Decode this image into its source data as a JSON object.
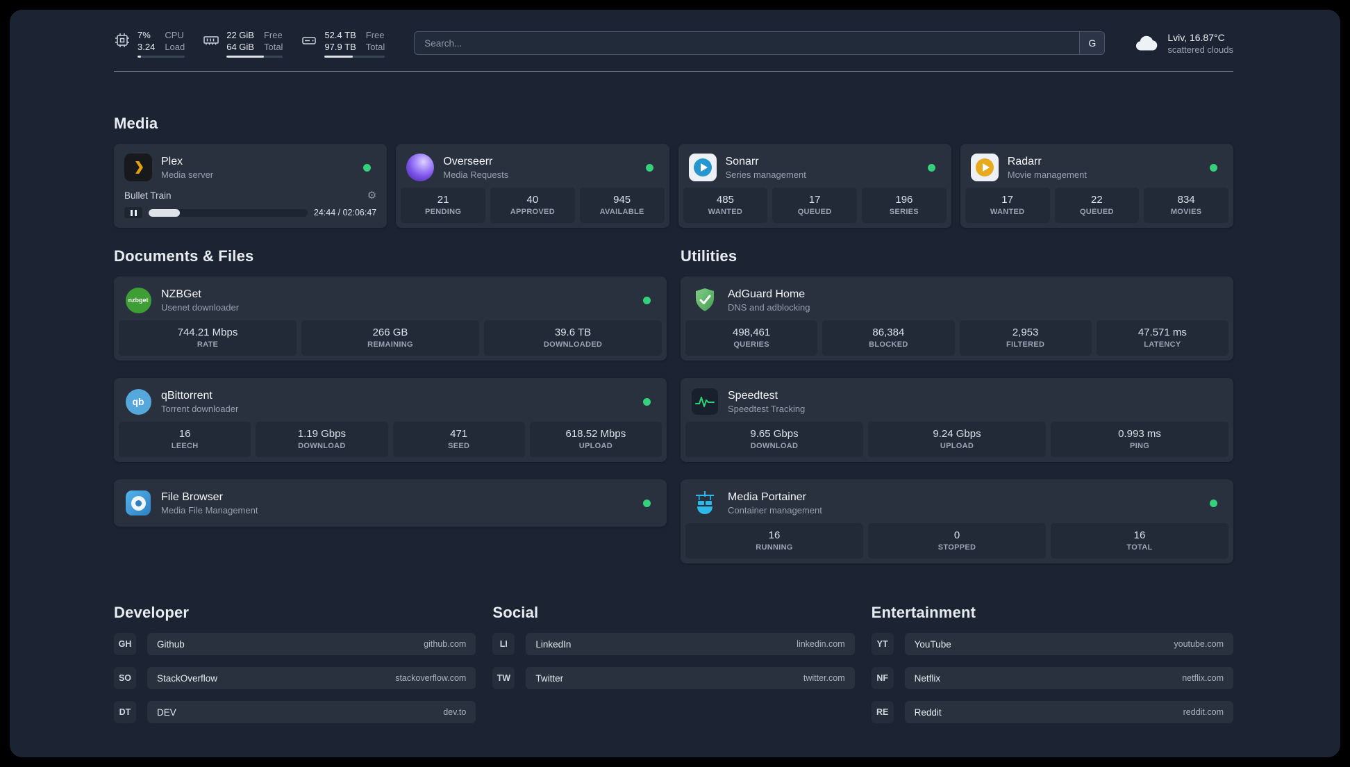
{
  "topbar": {
    "resources": [
      {
        "name": "cpu",
        "line1": "7%",
        "line2": "3.24",
        "label1": "CPU",
        "label2": "Load",
        "percent": 7
      },
      {
        "name": "memory",
        "line1": "22 GiB",
        "line2": "64 GiB",
        "label1": "Free",
        "label2": "Total",
        "percent": 66
      },
      {
        "name": "disk",
        "line1": "52.4 TB",
        "line2": "97.9 TB",
        "label1": "Free",
        "label2": "Total",
        "percent": 47
      }
    ],
    "search": {
      "placeholder": "Search...",
      "button_label": "G"
    },
    "weather": {
      "location": "Lviv, 16.87°C",
      "condition": "scattered clouds"
    }
  },
  "media": {
    "title": "Media",
    "plex": {
      "name": "Plex",
      "desc": "Media server",
      "status": "online",
      "now_playing": "Bullet Train",
      "time": "24:44 / 02:06:47",
      "progress_percent": 19.5
    },
    "overseerr": {
      "name": "Overseerr",
      "desc": "Media Requests",
      "status": "online",
      "stats": [
        {
          "value": "21",
          "label": "PENDING"
        },
        {
          "value": "40",
          "label": "APPROVED"
        },
        {
          "value": "945",
          "label": "AVAILABLE"
        }
      ]
    },
    "sonarr": {
      "name": "Sonarr",
      "desc": "Series management",
      "status": "online",
      "stats": [
        {
          "value": "485",
          "label": "WANTED"
        },
        {
          "value": "17",
          "label": "QUEUED"
        },
        {
          "value": "196",
          "label": "SERIES"
        }
      ]
    },
    "radarr": {
      "name": "Radarr",
      "desc": "Movie management",
      "status": "online",
      "stats": [
        {
          "value": "17",
          "label": "WANTED"
        },
        {
          "value": "22",
          "label": "QUEUED"
        },
        {
          "value": "834",
          "label": "MOVIES"
        }
      ]
    }
  },
  "documents": {
    "title": "Documents & Files",
    "nzbget": {
      "name": "NZBGet",
      "desc": "Usenet downloader",
      "status": "online",
      "icon_text": "nzbget",
      "stats": [
        {
          "value": "744.21 Mbps",
          "label": "RATE"
        },
        {
          "value": "266 GB",
          "label": "REMAINING"
        },
        {
          "value": "39.6 TB",
          "label": "DOWNLOADED"
        }
      ]
    },
    "qbittorrent": {
      "name": "qBittorrent",
      "desc": "Torrent downloader",
      "status": "online",
      "icon_text": "qb",
      "stats": [
        {
          "value": "16",
          "label": "LEECH"
        },
        {
          "value": "1.19 Gbps",
          "label": "DOWNLOAD"
        },
        {
          "value": "471",
          "label": "SEED"
        },
        {
          "value": "618.52 Mbps",
          "label": "UPLOAD"
        }
      ]
    },
    "filebrowser": {
      "name": "File Browser",
      "desc": "Media File Management",
      "status": "online"
    }
  },
  "utilities": {
    "title": "Utilities",
    "adguard": {
      "name": "AdGuard Home",
      "desc": "DNS and adblocking",
      "stats": [
        {
          "value": "498,461",
          "label": "QUERIES"
        },
        {
          "value": "86,384",
          "label": "BLOCKED"
        },
        {
          "value": "2,953",
          "label": "FILTERED"
        },
        {
          "value": "47.571 ms",
          "label": "LATENCY"
        }
      ]
    },
    "speedtest": {
      "name": "Speedtest",
      "desc": "Speedtest Tracking",
      "stats": [
        {
          "value": "9.65 Gbps",
          "label": "DOWNLOAD"
        },
        {
          "value": "9.24 Gbps",
          "label": "UPLOAD"
        },
        {
          "value": "0.993 ms",
          "label": "PING"
        }
      ]
    },
    "portainer": {
      "name": "Media Portainer",
      "desc": "Container management",
      "status": "online",
      "stats": [
        {
          "value": "16",
          "label": "RUNNING"
        },
        {
          "value": "0",
          "label": "STOPPED"
        },
        {
          "value": "16",
          "label": "TOTAL"
        }
      ]
    }
  },
  "bookmarks": [
    {
      "title": "Developer",
      "items": [
        {
          "abbr": "GH",
          "name": "Github",
          "url": "github.com"
        },
        {
          "abbr": "SO",
          "name": "StackOverflow",
          "url": "stackoverflow.com"
        },
        {
          "abbr": "DT",
          "name": "DEV",
          "url": "dev.to"
        }
      ]
    },
    {
      "title": "Social",
      "items": [
        {
          "abbr": "LI",
          "name": "LinkedIn",
          "url": "linkedin.com"
        },
        {
          "abbr": "TW",
          "name": "Twitter",
          "url": "twitter.com"
        }
      ]
    },
    {
      "title": "Entertainment",
      "items": [
        {
          "abbr": "YT",
          "name": "YouTube",
          "url": "youtube.com"
        },
        {
          "abbr": "NF",
          "name": "Netflix",
          "url": "netflix.com"
        },
        {
          "abbr": "RE",
          "name": "Reddit",
          "url": "reddit.com"
        }
      ]
    }
  ],
  "colors": {
    "background": "#1c2433",
    "card": "#29313f",
    "tile": "#222a38",
    "status_online": "#35d07c",
    "accent_plex": "#e5a00d"
  }
}
